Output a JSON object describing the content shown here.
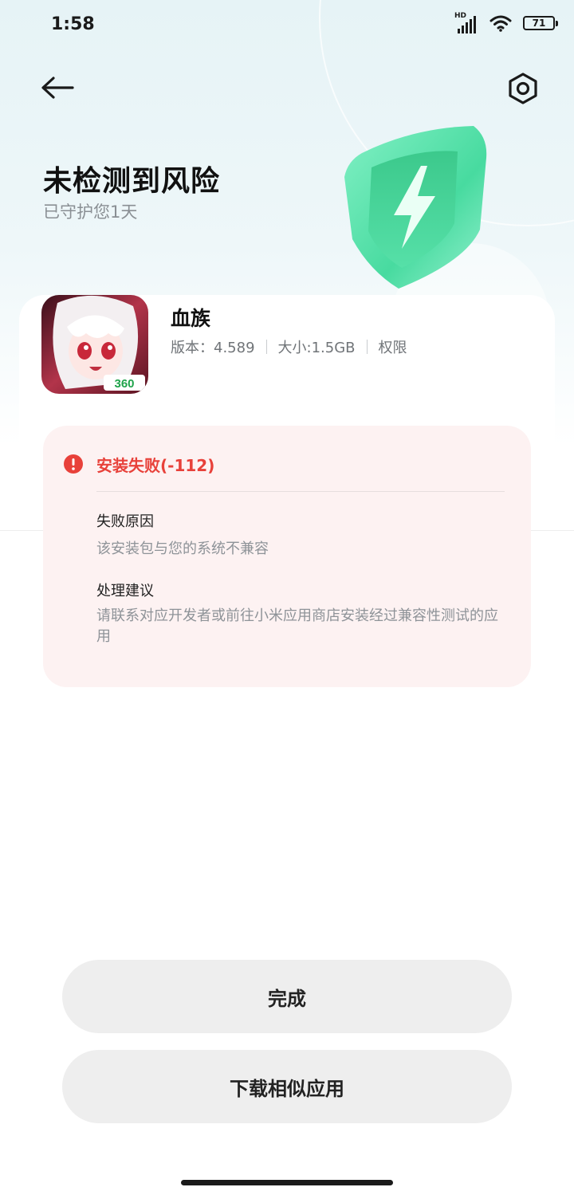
{
  "status_bar": {
    "time": "1:58",
    "network_label": "HD",
    "battery": "71"
  },
  "header": {
    "back_icon": "arrow-left-icon",
    "settings_icon": "hexagon-settings-icon",
    "title": "未检测到风险",
    "subtitle": "已守护您1天"
  },
  "app": {
    "name": "血族",
    "version": "版本：4.589",
    "size": "大小:1.5GB",
    "permissions": "权限",
    "icon_badge": "360"
  },
  "error": {
    "title": "安装失败(-112)",
    "reason_label": "失败原因",
    "reason_text": "该安装包与您的系统不兼容",
    "suggestion_label": "处理建议",
    "suggestion_text": "请联系对应开发者或前往小米应用商店安装经过兼容性测试的应用",
    "color": "#e8413a"
  },
  "actions": {
    "done_label": "完成",
    "similar_label": "下载相似应用"
  },
  "colors": {
    "shield_accent": "#3fd99b",
    "error_bg": "#fdf2f2",
    "button_bg": "#eeeeee"
  }
}
